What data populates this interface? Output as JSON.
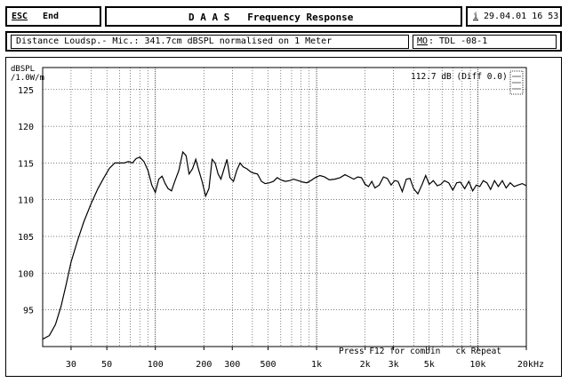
{
  "header": {
    "esc_key": "ESC",
    "esc_label": "End",
    "title": "D A A S   Frequency Response",
    "info_key": "i",
    "datetime": "29.04.01 16 53"
  },
  "subheader": {
    "description": "Distance Loudsp.- Mic.: 341.7cm dBSPL normalised on 1 Meter",
    "mo_key": "MO",
    "mo_value": ": TDL -08-1"
  },
  "status": {
    "footer_hint": "Press F12 for combin   ck Repeat"
  },
  "chart_data": {
    "type": "line",
    "ylabel": "dBSPL /1.0W/m",
    "xlabel": "",
    "ylim": [
      90,
      128
    ],
    "xlim": [
      20,
      20000
    ],
    "xscale": "log",
    "grid": true,
    "y_ticks": [
      95,
      100,
      105,
      110,
      115,
      120,
      125
    ],
    "x_ticks": [
      {
        "value": 30,
        "label": "30"
      },
      {
        "value": 50,
        "label": "50"
      },
      {
        "value": 100,
        "label": "100"
      },
      {
        "value": 200,
        "label": "200"
      },
      {
        "value": 300,
        "label": "300"
      },
      {
        "value": 500,
        "label": "500"
      },
      {
        "value": 1000,
        "label": "1k"
      },
      {
        "value": 2000,
        "label": "2k"
      },
      {
        "value": 3000,
        "label": "3k"
      },
      {
        "value": 5000,
        "label": "5k"
      },
      {
        "value": 10000,
        "label": "10k"
      },
      {
        "value": 20000,
        "label": "20kHz"
      }
    ],
    "annotation": "112.7 dB (Diff 0.0)",
    "series": [
      {
        "x": [
          20,
          22,
          24,
          26,
          28,
          30,
          33,
          36,
          40,
          44,
          48,
          52,
          56,
          60,
          64,
          68,
          72,
          76,
          80,
          85,
          90,
          95,
          100,
          105,
          110,
          115,
          120,
          126,
          132,
          140,
          148,
          155,
          162,
          170,
          178,
          186,
          195,
          205,
          215,
          225,
          235,
          245,
          255,
          265,
          278,
          290,
          305,
          320,
          335,
          350,
          370,
          390,
          410,
          430,
          455,
          480,
          510,
          540,
          570,
          600,
          640,
          680,
          720,
          770,
          820,
          870,
          920,
          980,
          1050,
          1120,
          1200,
          1300,
          1400,
          1500,
          1600,
          1700,
          1800,
          1900,
          2000,
          2100,
          2200,
          2300,
          2450,
          2600,
          2750,
          2900,
          3050,
          3200,
          3400,
          3600,
          3800,
          4000,
          4250,
          4500,
          4750,
          5000,
          5300,
          5600,
          5900,
          6200,
          6600,
          7000,
          7400,
          7800,
          8300,
          8800,
          9300,
          9800,
          10300,
          10800,
          11400,
          12000,
          12700,
          13400,
          14200,
          15000,
          15900,
          16800,
          17800,
          18900,
          20000
        ],
        "y": [
          91,
          91.5,
          93,
          95.5,
          98.5,
          101.5,
          104.5,
          107,
          109.5,
          111.5,
          113,
          114.3,
          115,
          115,
          115,
          115.2,
          115,
          115.6,
          115.8,
          115.2,
          114,
          112,
          111,
          112.8,
          113.2,
          112.2,
          111.5,
          111.2,
          112.5,
          114,
          116.5,
          116,
          113.5,
          114.2,
          115.5,
          114,
          112.5,
          110.5,
          111.5,
          115.5,
          115,
          113.5,
          112.8,
          114,
          115.5,
          113,
          112.5,
          114,
          115,
          114.5,
          114.2,
          113.8,
          113.6,
          113.5,
          112.5,
          112.2,
          112.3,
          112.5,
          113,
          112.7,
          112.5,
          112.6,
          112.8,
          112.6,
          112.4,
          112.3,
          112.6,
          113,
          113.3,
          113.1,
          112.7,
          112.8,
          113,
          113.4,
          113.1,
          112.8,
          113.1,
          113,
          112.1,
          111.8,
          112.5,
          111.6,
          112,
          113.1,
          112.9,
          112,
          112.6,
          112.5,
          111.1,
          112.8,
          112.9,
          111.5,
          110.8,
          112,
          113.3,
          112.1,
          112.6,
          111.9,
          112.1,
          112.6,
          112.3,
          111.3,
          112.3,
          112.4,
          111.5,
          112.5,
          111.2,
          112,
          111.8,
          112.6,
          112.3,
          111.4,
          112.6,
          111.8,
          112.6,
          111.6,
          112.3,
          111.8,
          112,
          112.2,
          111.9
        ]
      }
    ]
  }
}
